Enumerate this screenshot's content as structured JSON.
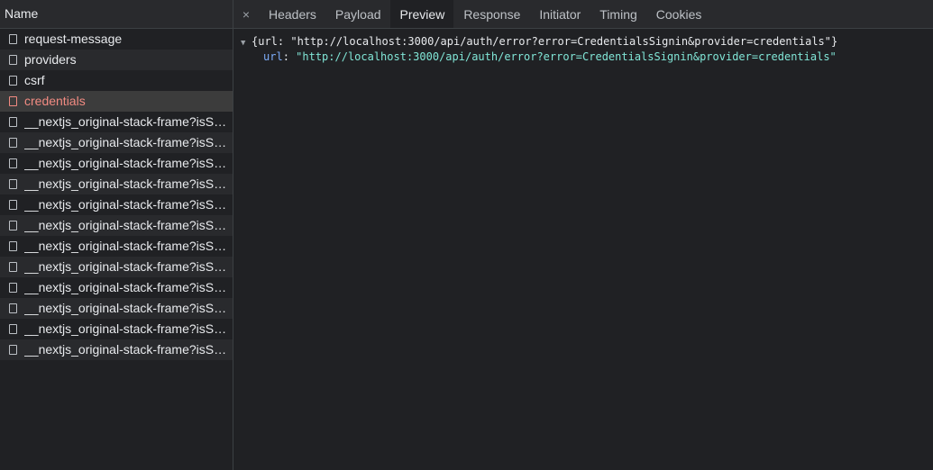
{
  "request_list": {
    "header": "Name",
    "items": [
      {
        "label": "request-message",
        "selected": false
      },
      {
        "label": "providers",
        "selected": false
      },
      {
        "label": "csrf",
        "selected": false
      },
      {
        "label": "credentials",
        "selected": true
      },
      {
        "label": "__nextjs_original-stack-frame?isServer=false",
        "selected": false
      },
      {
        "label": "__nextjs_original-stack-frame?isServer=false",
        "selected": false
      },
      {
        "label": "__nextjs_original-stack-frame?isServer=false",
        "selected": false
      },
      {
        "label": "__nextjs_original-stack-frame?isServer=false",
        "selected": false
      },
      {
        "label": "__nextjs_original-stack-frame?isServer=false",
        "selected": false
      },
      {
        "label": "__nextjs_original-stack-frame?isServer=false",
        "selected": false
      },
      {
        "label": "__nextjs_original-stack-frame?isServer=false",
        "selected": false
      },
      {
        "label": "__nextjs_original-stack-frame?isServer=false",
        "selected": false
      },
      {
        "label": "__nextjs_original-stack-frame?isServer=false",
        "selected": false
      },
      {
        "label": "__nextjs_original-stack-frame?isServer=false",
        "selected": false
      },
      {
        "label": "__nextjs_original-stack-frame?isServer=false",
        "selected": false
      },
      {
        "label": "__nextjs_original-stack-frame?isServer=false",
        "selected": false
      }
    ]
  },
  "details": {
    "close_icon": "×",
    "tabs": [
      {
        "label": "Headers",
        "active": false
      },
      {
        "label": "Payload",
        "active": false
      },
      {
        "label": "Preview",
        "active": true
      },
      {
        "label": "Response",
        "active": false
      },
      {
        "label": "Initiator",
        "active": false
      },
      {
        "label": "Timing",
        "active": false
      },
      {
        "label": "Cookies",
        "active": false
      }
    ],
    "preview": {
      "summary": "{url: \"http://localhost:3000/api/auth/error?error=CredentialsSignin&provider=credentials\"}",
      "property_key": "url",
      "property_separator": ": ",
      "property_value": "\"http://localhost:3000/api/auth/error?error=CredentialsSignin&provider=credentials\""
    }
  },
  "colors": {
    "background": "#202124",
    "selected_text": "#f28b82",
    "json_key": "#7cacf8",
    "json_string": "#80e5d6"
  }
}
